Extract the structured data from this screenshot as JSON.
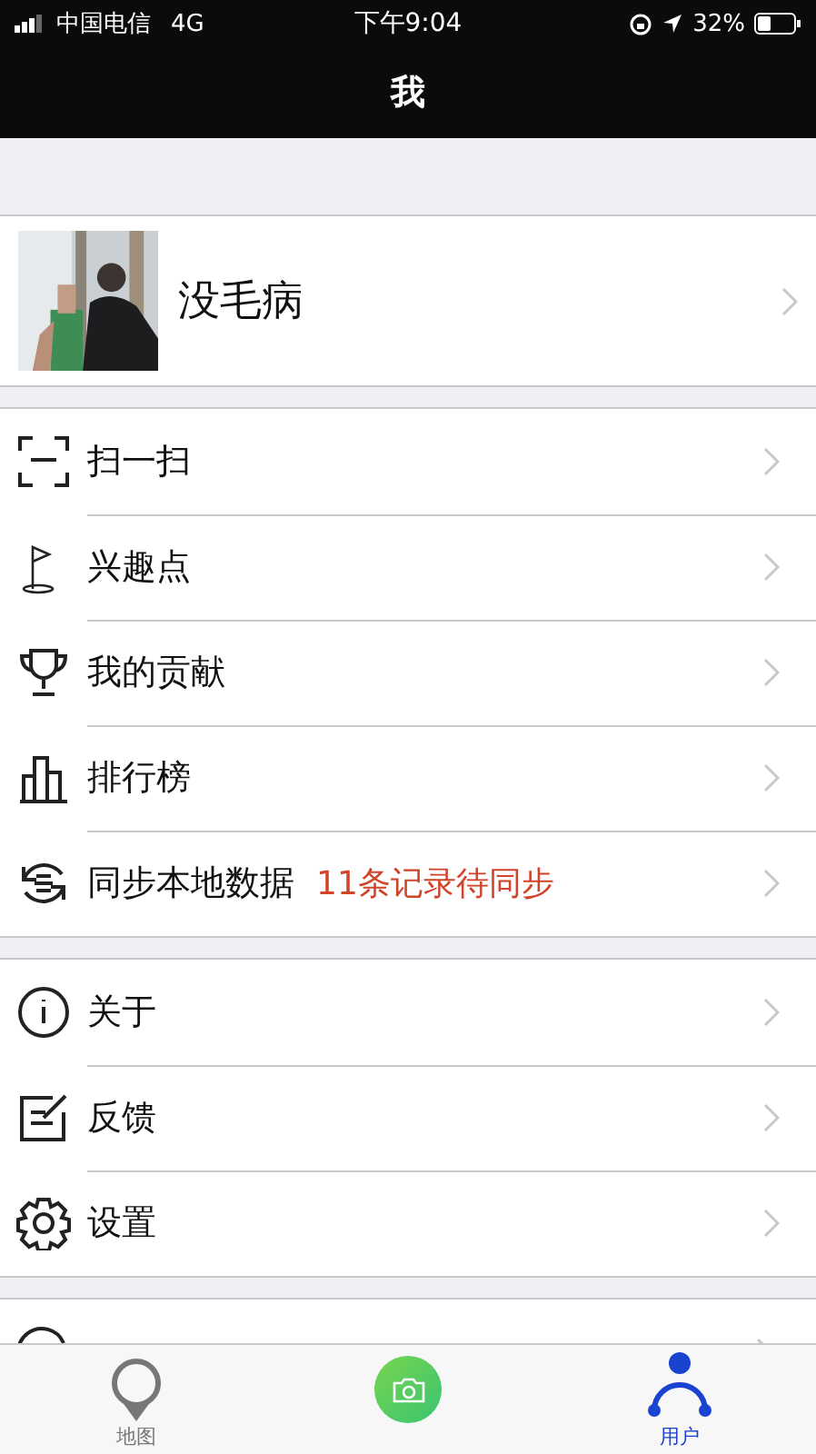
{
  "status_bar": {
    "carrier": "中国电信",
    "network": "4G",
    "time": "下午9:04",
    "battery": "32%"
  },
  "nav": {
    "title": "我"
  },
  "profile": {
    "name": "没毛病"
  },
  "groups": [
    {
      "items": [
        {
          "label": "扫一扫"
        },
        {
          "label": "兴趣点"
        },
        {
          "label": "我的贡献"
        },
        {
          "label": "排行榜"
        },
        {
          "label": "同步本地数据",
          "note": "11条记录待同步"
        }
      ]
    },
    {
      "items": [
        {
          "label": "关于"
        },
        {
          "label": "反馈"
        },
        {
          "label": "设置"
        }
      ]
    },
    {
      "items": [
        {
          "kind": "cut_off"
        }
      ]
    }
  ],
  "tab_bar": [
    {
      "kind": "tab",
      "label": "地图",
      "selected": false
    },
    {
      "kind": "camera"
    },
    {
      "kind": "tab",
      "label": "用户",
      "selected": true
    }
  ]
}
